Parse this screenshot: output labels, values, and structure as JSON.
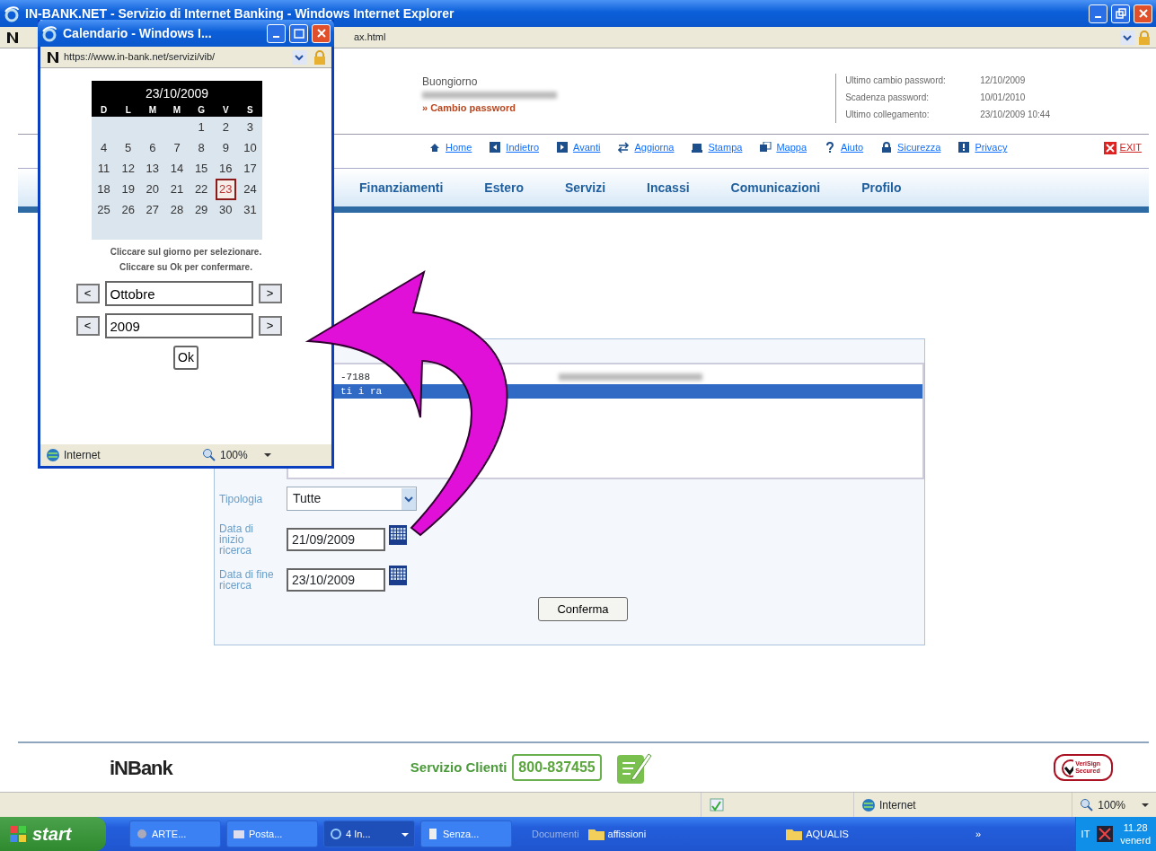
{
  "window": {
    "title": "IN-BANK.NET - Servizio di Internet Banking - Windows Internet Explorer",
    "address": "ax.html"
  },
  "header": {
    "greeting": "Buongiorno",
    "link": "» Cambio password",
    "info": [
      {
        "label": "Ultimo cambio password:",
        "value": "12/10/2009"
      },
      {
        "label": "Scadenza password:",
        "value": "10/01/2010"
      },
      {
        "label": "Ultimo collegamento:",
        "value": "23/10/2009 10:44"
      }
    ]
  },
  "toolbar": [
    {
      "kind": "home",
      "label": "Home"
    },
    {
      "kind": "back",
      "label": "Indietro"
    },
    {
      "kind": "forward",
      "label": "Avanti"
    },
    {
      "kind": "refresh",
      "label": "Aggiorna"
    },
    {
      "kind": "print",
      "label": "Stampa"
    },
    {
      "kind": "map",
      "label": "Mappa"
    },
    {
      "kind": "help",
      "label": "Aiuto"
    },
    {
      "kind": "lock",
      "label": "Sicurezza"
    },
    {
      "kind": "privacy",
      "label": "Privacy"
    },
    {
      "kind": "exit",
      "label": "EXIT"
    }
  ],
  "menu": [
    {
      "label": "Finanziamenti"
    },
    {
      "label": "Estero"
    },
    {
      "label": "Servizi"
    },
    {
      "label": "Incassi"
    },
    {
      "label": "Comunicazioni"
    },
    {
      "label": "Profilo"
    }
  ],
  "form": {
    "accounts": [
      {
        "text": "-7188",
        "selected": false
      },
      {
        "text": "ti i ra",
        "selected": true
      }
    ],
    "fields": [
      {
        "kind": "select",
        "label": "Tipologia",
        "value": "Tutte"
      },
      {
        "kind": "date",
        "label": "Data di inizio ricerca",
        "value": "21/09/2009"
      },
      {
        "kind": "date",
        "label": "Data di fine ricerca",
        "value": "23/10/2009"
      }
    ],
    "submit": "Conferma"
  },
  "footer": {
    "logo": "iNBank",
    "service": "Servizio Clienti",
    "phone": "800-837455",
    "seal": "VeriSign Secured"
  },
  "status_bar": {
    "zone": "Internet",
    "zoom": "100%"
  },
  "popup": {
    "title": "Calendario - Windows I...",
    "address": "https://www.in-bank.net/servizi/vib/",
    "date": "23/10/2009",
    "weekdays": [
      "D",
      "L",
      "M",
      "M",
      "G",
      "V",
      "S"
    ],
    "weeks": [
      {
        "days": [
          {
            "label": "1",
            "selected": false
          },
          {
            "label": "2",
            "selected": false
          },
          {
            "label": "3",
            "selected": false
          }
        ]
      },
      {
        "days": [
          {
            "label": "4",
            "selected": false
          },
          {
            "label": "5",
            "selected": false
          },
          {
            "label": "6",
            "selected": false
          },
          {
            "label": "7",
            "selected": false
          },
          {
            "label": "8",
            "selected": false
          },
          {
            "label": "9",
            "selected": false
          },
          {
            "label": "10",
            "selected": false
          }
        ]
      },
      {
        "days": [
          {
            "label": "11",
            "selected": false
          },
          {
            "label": "12",
            "selected": false
          },
          {
            "label": "13",
            "selected": false
          },
          {
            "label": "14",
            "selected": false
          },
          {
            "label": "15",
            "selected": false
          },
          {
            "label": "16",
            "selected": false
          },
          {
            "label": "17",
            "selected": false
          }
        ]
      },
      {
        "days": [
          {
            "label": "18",
            "selected": false
          },
          {
            "label": "19",
            "selected": false
          },
          {
            "label": "20",
            "selected": false
          },
          {
            "label": "21",
            "selected": false
          },
          {
            "label": "22",
            "selected": false
          },
          {
            "label": "23",
            "selected": true
          },
          {
            "label": "24",
            "selected": false
          }
        ]
      },
      {
        "days": [
          {
            "label": "25",
            "selected": false
          },
          {
            "label": "26",
            "selected": false
          },
          {
            "label": "27",
            "selected": false
          },
          {
            "label": "28",
            "selected": false
          },
          {
            "label": "29",
            "selected": false
          },
          {
            "label": "30",
            "selected": false
          },
          {
            "label": "31",
            "selected": false
          }
        ]
      }
    ],
    "hints": [
      "Cliccare sul giorno per selezionare.",
      "Cliccare su Ok per confermare."
    ],
    "pickers": [
      {
        "prev": "<",
        "value": "Ottobre",
        "next": ">"
      },
      {
        "prev": "<",
        "value": "2009",
        "next": ">"
      }
    ],
    "ok": "Ok",
    "status_zone": "Internet",
    "status_zoom": "100%"
  },
  "taskbar": {
    "start": "start",
    "items": [
      {
        "kind": "app",
        "label": "ARTE...",
        "selected": false
      },
      {
        "kind": "mail",
        "label": "Posta...",
        "selected": false
      },
      {
        "kind": "browser",
        "label": "4 In...",
        "selected": true
      },
      {
        "kind": "doc",
        "label": "Senza...",
        "selected": false
      }
    ],
    "toolbar_label": "Documenti",
    "folders": [
      {
        "label": "affissioni"
      },
      {
        "label": "AQUALIS"
      }
    ],
    "more": "»",
    "language": "IT",
    "time": "11.28",
    "day": "venerd"
  }
}
